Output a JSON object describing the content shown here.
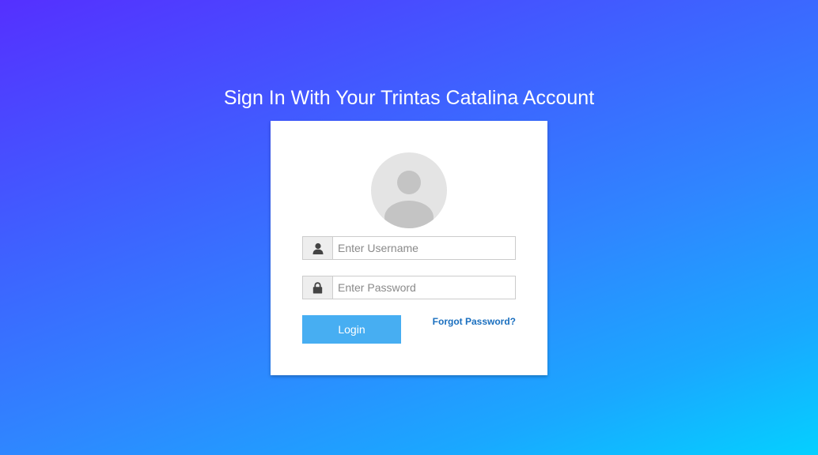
{
  "page": {
    "title": "Sign In With Your Trintas Catalina Account"
  },
  "login_form": {
    "avatar_icon": "user-avatar-icon",
    "username": {
      "icon": "user-icon",
      "placeholder": "Enter Username",
      "value": ""
    },
    "password": {
      "icon": "lock-icon",
      "placeholder": "Enter Password",
      "value": ""
    },
    "login_label": "Login",
    "forgot_label": "Forgot Password?"
  },
  "colors": {
    "gradient_start": "#5530ff",
    "gradient_end": "#04d0ff",
    "login_button": "#47aef2",
    "link": "#1a6fbf",
    "card": "#ffffff"
  }
}
